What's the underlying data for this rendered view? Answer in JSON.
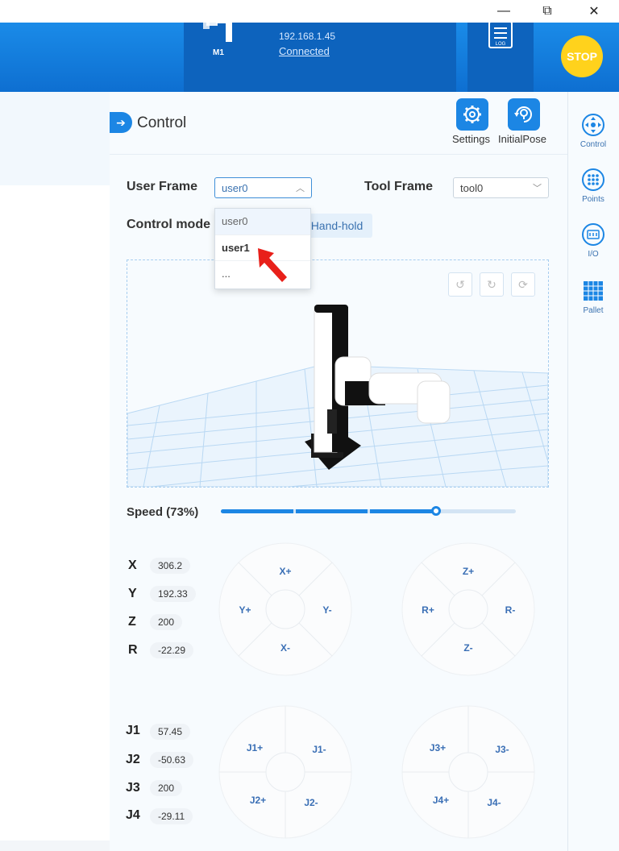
{
  "window_controls": {
    "minimize": "—",
    "restore": "⧉",
    "close": "✕"
  },
  "header": {
    "device_name": "M1",
    "ip": "192.168.1.45",
    "status": "Connected",
    "log_label": "LOG",
    "stop_label": "STOP"
  },
  "control": {
    "title": "Control",
    "settings_label": "Settings",
    "initial_pose_label": "InitialPose"
  },
  "frames": {
    "user_frame_label": "User Frame",
    "user_frame_value": "user0",
    "tool_frame_label": "Tool Frame",
    "tool_frame_value": "tool0",
    "control_mode_label": "Control mode",
    "mode_button": "Hand-hold"
  },
  "dropdown": {
    "options": [
      "user0",
      "user1",
      "..."
    ]
  },
  "speed": {
    "label": "Speed (73%)",
    "percent": 73
  },
  "cartesian": [
    {
      "axis": "X",
      "value": "306.2"
    },
    {
      "axis": "Y",
      "value": "192.33"
    },
    {
      "axis": "Z",
      "value": "200"
    },
    {
      "axis": "R",
      "value": "-22.29"
    }
  ],
  "joints": [
    {
      "axis": "J1",
      "value": "57.45"
    },
    {
      "axis": "J2",
      "value": "-50.63"
    },
    {
      "axis": "J3",
      "value": "200"
    },
    {
      "axis": "J4",
      "value": "-29.11"
    }
  ],
  "jog_xy": {
    "up": "X+",
    "left": "Y+",
    "right": "Y-",
    "down": "X-"
  },
  "jog_zr": {
    "up": "Z+",
    "left": "R+",
    "right": "R-",
    "down": "Z-"
  },
  "jog_j12": {
    "tl": "J1+",
    "tr": "J1-",
    "bl": "J2+",
    "br": "J2-"
  },
  "jog_j34": {
    "tl": "J3+",
    "tr": "J3-",
    "bl": "J4+",
    "br": "J4-"
  },
  "sidebar": {
    "items": [
      {
        "label": "Control",
        "icon": "move-icon"
      },
      {
        "label": "Points",
        "icon": "points-grid-icon"
      },
      {
        "label": "I/O",
        "icon": "io-icon"
      },
      {
        "label": "Pallet",
        "icon": "pallet-icon"
      }
    ]
  },
  "colors": {
    "primary": "#1c86e4",
    "header_dark": "#0d63bd",
    "stop": "#ffd21c",
    "jog_text": "#3a6fb5"
  }
}
